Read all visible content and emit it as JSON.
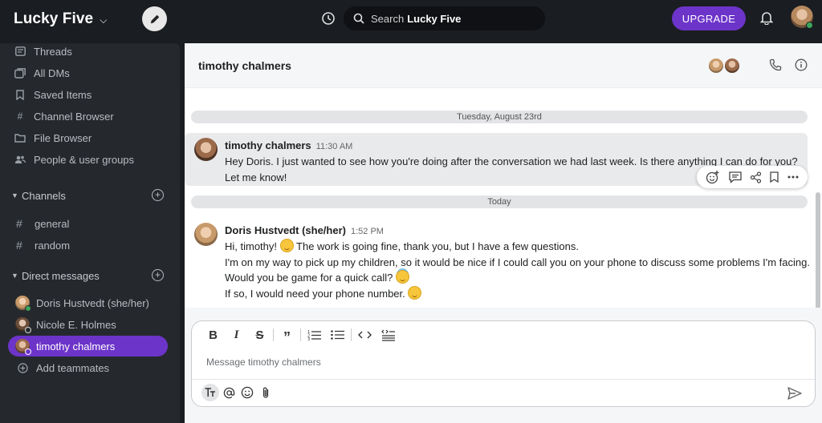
{
  "workspace": {
    "name": "Lucky Five"
  },
  "topbar": {
    "search_prefix": "Search",
    "search_scope": "Lucky Five",
    "upgrade_label": "UPGRADE"
  },
  "sidebar": {
    "nav": [
      {
        "label": "Threads",
        "icon": "threads-icon"
      },
      {
        "label": "All DMs",
        "icon": "all-dms-icon"
      },
      {
        "label": "Saved Items",
        "icon": "bookmark-icon"
      },
      {
        "label": "Channel Browser",
        "icon": "channel-browser-icon"
      },
      {
        "label": "File Browser",
        "icon": "file-browser-icon"
      },
      {
        "label": "People & user groups",
        "icon": "people-icon"
      }
    ],
    "channels_title": "Channels",
    "channels": [
      {
        "label": "general"
      },
      {
        "label": "random"
      }
    ],
    "dms_title": "Direct messages",
    "dms": [
      {
        "label": "Doris Hustvedt (she/her)",
        "status_color": "#3ba55c"
      },
      {
        "label": "Nicole E. Holmes",
        "status_color": "#d7d7d7"
      },
      {
        "label": "timothy chalmers",
        "status_color": "#d7d7d7",
        "active": true
      }
    ],
    "add_teammates": "Add teammates"
  },
  "channel": {
    "title": "timothy chalmers"
  },
  "messages": {
    "divider_1": "Tuesday, August 23rd",
    "divider_2": "Today",
    "m1": {
      "author": "timothy chalmers",
      "time": "11:30 AM",
      "text": "Hey Doris. I just wanted to see how you're doing after the conversation we had last week. Is there anything I can do for you? Let me know!"
    },
    "m2": {
      "author": "Doris Hustvedt (she/her)",
      "time": "1:52 PM",
      "line1_a": "Hi, timothy!",
      "line1_b": "The work is going fine, thank you, but I have a few questions.",
      "line2": "I'm on my way to pick up my children, so it would be nice if I could call you on your phone to discuss some problems I'm facing.",
      "line3": "Would you be game for a quick call?",
      "line4": "If so, I would need your phone number."
    }
  },
  "composer": {
    "placeholder": "Message timothy chalmers"
  },
  "colors": {
    "accent": "#6c34c9",
    "online": "#3ba55c",
    "sidebar_bg": "#25292e",
    "topbar_bg": "#1a1d21"
  }
}
